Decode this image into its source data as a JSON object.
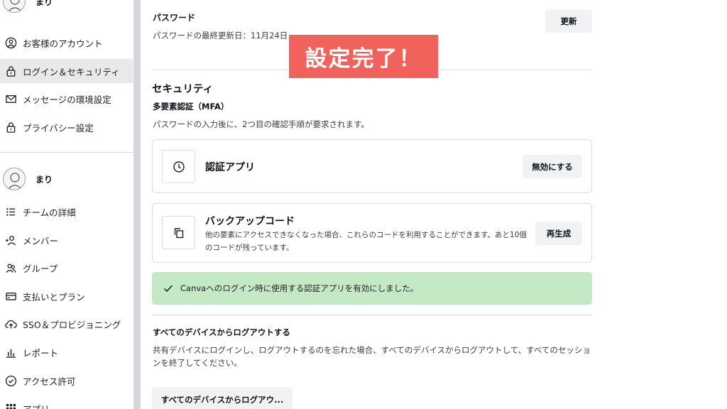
{
  "sidebar": {
    "profile_top": {
      "name": "まり"
    },
    "account_items": [
      {
        "label": "お客様のアカウント",
        "icon": "user-circle-icon"
      },
      {
        "label": "ログイン＆セキュリティ",
        "icon": "lock-icon",
        "active": true
      },
      {
        "label": "メッセージの環境設定",
        "icon": "mail-icon"
      },
      {
        "label": "プライバシー設定",
        "icon": "lock-icon"
      }
    ],
    "profile_team": {
      "name": "まり"
    },
    "team_items": [
      {
        "label": "チームの詳細",
        "icon": "list-icon"
      },
      {
        "label": "メンバー",
        "icon": "add-person-icon"
      },
      {
        "label": "グループ",
        "icon": "group-icon"
      },
      {
        "label": "支払いとプラン",
        "icon": "credit-card-icon"
      },
      {
        "label": "SSO＆プロビジョニング",
        "icon": "cloud-upload-icon"
      },
      {
        "label": "レポート",
        "icon": "bar-chart-icon"
      },
      {
        "label": "アクセス許可",
        "icon": "check-circle-icon"
      },
      {
        "label": "アプリ",
        "icon": "grid-icon"
      }
    ]
  },
  "password": {
    "label": "パスワード",
    "updated": "パスワードの最終更新日：11月24日",
    "update_button": "更新"
  },
  "security": {
    "title": "セキュリティ",
    "mfa_label": "多要素認証（MFA）",
    "mfa_desc": "パスワードの入力後に、2つ目の確認手順が要求されます。",
    "auth_app": {
      "title": "認証アプリ",
      "button": "無効にする",
      "icon": "clock-icon"
    },
    "backup_codes": {
      "title": "バックアップコード",
      "desc": "他の要素にアクセスできなくなった場合、これらのコードを利用することができます。あと10個のコードが残っています。",
      "button": "再生成",
      "icon": "copy-icon"
    },
    "success_message": "Canvaへのログイン時に使用する認証アプリを有効にしました。"
  },
  "logout": {
    "title": "すべてのデバイスからログアウトする",
    "desc": "共有デバイスにログインし、ログアウトするのを忘れた場合、すべてのデバイスからログアウトして、すべてのセッションを終了してください。",
    "button": "すべてのデバイスからログアウ..."
  },
  "banner": {
    "text": "設定完了！",
    "color": "#f0625b"
  },
  "colors": {
    "success_bg": "#c5e9c4",
    "active_nav": "#e8e9eb"
  }
}
